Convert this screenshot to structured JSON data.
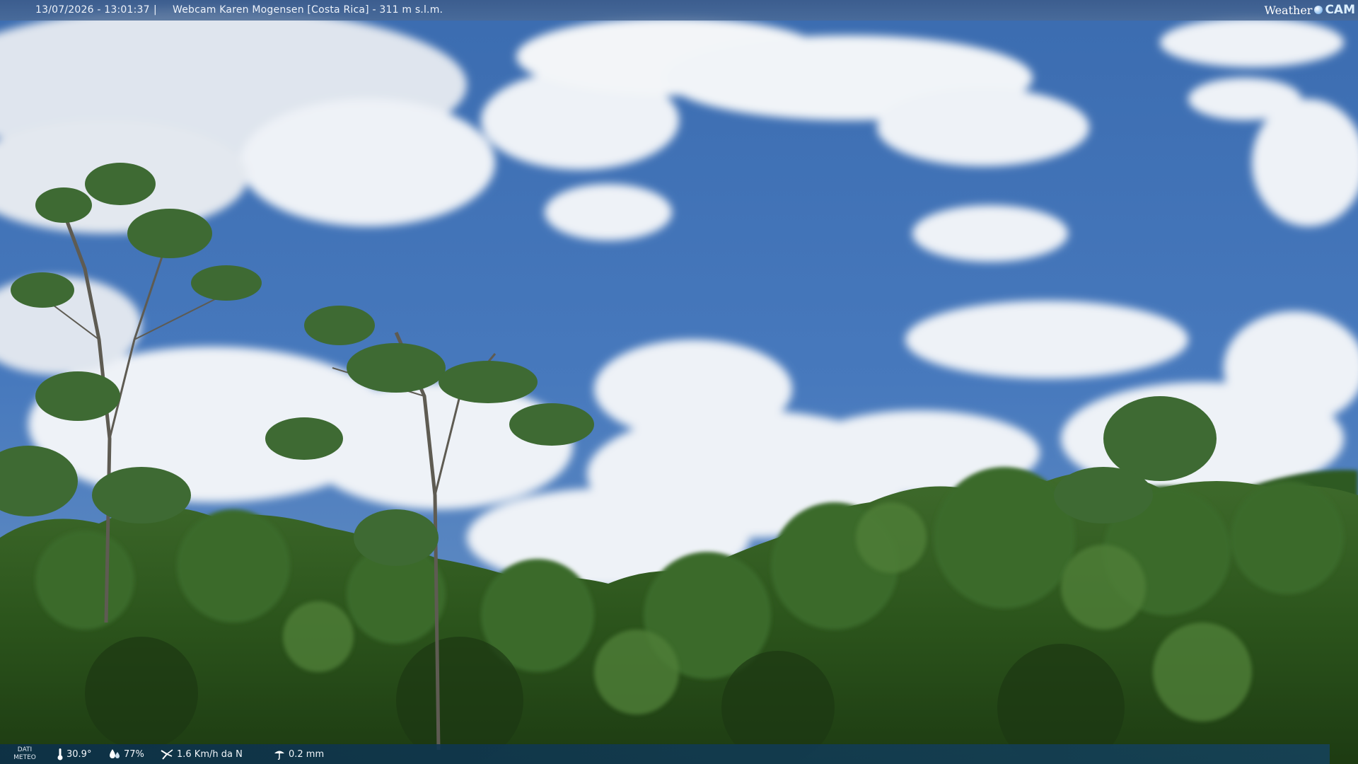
{
  "header": {
    "datetime": "13/07/2026 - 13:01:37",
    "separator": "|",
    "title": "Webcam Karen Mogensen [Costa Rica]  - 311 m s.l.m."
  },
  "brand": {
    "weather": "Weather",
    "cam": "CAM"
  },
  "weather_bar": {
    "label_line1": "DATI",
    "label_line2": "METEO",
    "temperature": "30.9°",
    "humidity": "77%",
    "wind": "1.6 Km/h da N",
    "rain": "0.2 mm"
  },
  "icons": [
    "thermometer-icon",
    "humidity-drops-icon",
    "wind-icon",
    "rain-icon"
  ],
  "colors": {
    "sky": "#3f74b8",
    "foliage": "#2e5a1e",
    "topbar": "#4a6a96",
    "bottombar": "#14425f"
  }
}
